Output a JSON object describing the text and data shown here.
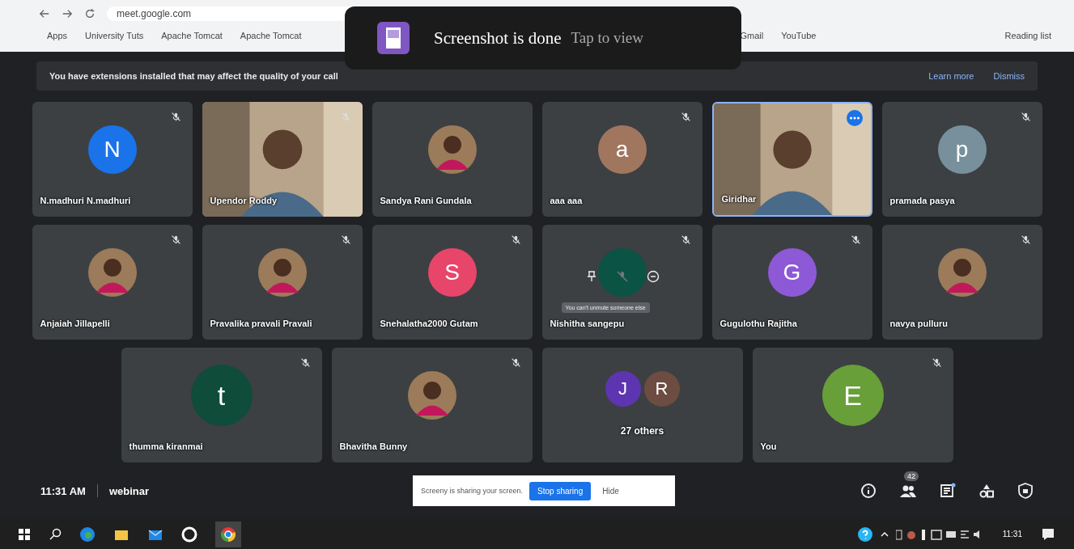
{
  "browser": {
    "url": "meet.google.com",
    "bookmarks": [
      "Apps",
      "University Tuts",
      "Apache Tomcat",
      "Apache Tomcat",
      "Gmail",
      "YouTube",
      "Reading list"
    ]
  },
  "toast": {
    "title": "Screenshot is done",
    "action": "Tap to view"
  },
  "banner": {
    "message": "You have extensions installed that may affect the quality of your call",
    "links": [
      "Learn more",
      "Dismiss"
    ]
  },
  "rows": [
    [
      {
        "name": "N.madhuri N.madhuri",
        "kind": "letter",
        "letter": "N",
        "color": "#1a73e8",
        "muted": true,
        "selected": false,
        "hovered": false
      },
      {
        "name": "Upendor Roddy",
        "kind": "video",
        "muted": true,
        "selected": false,
        "hovered": false
      },
      {
        "name": "Sandya Rani Gundala",
        "muted": false,
        "selected": false,
        "hovered": false
      },
      {
        "name": "aaa aaa",
        "kind": "letter",
        "letter": "a",
        "color": "#a1765e",
        "muted": true,
        "selected": false,
        "hovered": false
      },
      {
        "name": "Giridhar",
        "kind": "video",
        "muted": false,
        "selected": true,
        "hovered": false
      },
      {
        "name": "pramada pasya",
        "kind": "letter",
        "letter": "p",
        "color": "#78909c",
        "muted": true,
        "selected": false,
        "hovered": false
      }
    ],
    [
      {
        "name": "Anjaiah Jillapelli",
        "muted": true,
        "selected": false,
        "hovered": false
      },
      {
        "name": "Pravalika pravali Pravali",
        "muted": true,
        "selected": false,
        "hovered": false
      },
      {
        "name": "Snehalatha2000 Gutam",
        "kind": "letter",
        "letter": "S",
        "color": "#e8456b",
        "muted": true,
        "selected": false,
        "hovered": false
      },
      {
        "name": "Nishitha sangepu",
        "kind": "letter",
        "color": "#0b5345",
        "muted": true,
        "selected": false,
        "hovered": true,
        "tooltip": "You can't unmute someone else"
      },
      {
        "name": "Gugulothu Rajitha",
        "kind": "letter",
        "letter": "G",
        "color": "#8e59d6",
        "muted": true,
        "selected": false,
        "hovered": false
      },
      {
        "name": "navya pulluru",
        "muted": true,
        "selected": false,
        "hovered": false
      }
    ],
    [
      {
        "name": "thumma kiranmai",
        "kind": "letter",
        "letter": "t",
        "color": "#0f4c3a",
        "muted": true,
        "selected": false,
        "hovered": false
      },
      {
        "name": "Bhavitha Bunny",
        "muted": true,
        "selected": false,
        "hovered": false
      },
      {
        "name": "27 others",
        "kind": "others",
        "letters": [
          {
            "letter": "J",
            "color": "#5e35b1"
          },
          {
            "letter": "R",
            "color": "#6d4c41"
          }
        ],
        "muted": false,
        "selected": false,
        "hovered": false
      },
      {
        "name": "You",
        "kind": "letter",
        "letter": "E",
        "color": "#689f38",
        "muted": true,
        "selected": false,
        "hovered": false
      }
    ]
  ],
  "footer": {
    "time": "11:31 AM",
    "meeting": "webinar",
    "people_count": "42"
  },
  "share_bar": {
    "message": "Screeny is sharing your screen.",
    "stop": "Stop sharing",
    "hide": "Hide"
  },
  "taskbar": {
    "clock": "11:31"
  }
}
